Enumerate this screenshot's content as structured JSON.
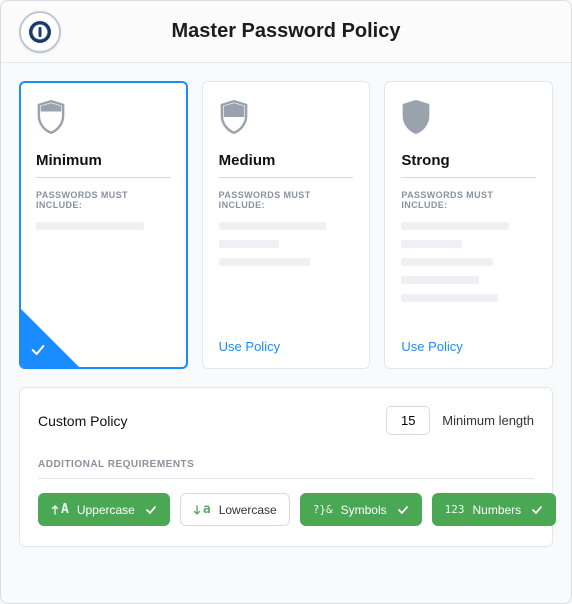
{
  "header": {
    "title": "Master Password Policy"
  },
  "policies": {
    "subhead": "PASSWORDS MUST INCLUDE:",
    "use_policy_label": "Use Policy",
    "minimum": {
      "name": "Minimum"
    },
    "medium": {
      "name": "Medium"
    },
    "strong": {
      "name": "Strong"
    }
  },
  "custom": {
    "title": "Custom Policy",
    "min_length_value": "15",
    "min_length_label": "Minimum length",
    "subhead": "ADDITIONAL REQUIREMENTS",
    "chips": {
      "uppercase": "Uppercase",
      "lowercase": "Lowercase",
      "symbols": "Symbols",
      "numbers": "Numbers"
    }
  }
}
